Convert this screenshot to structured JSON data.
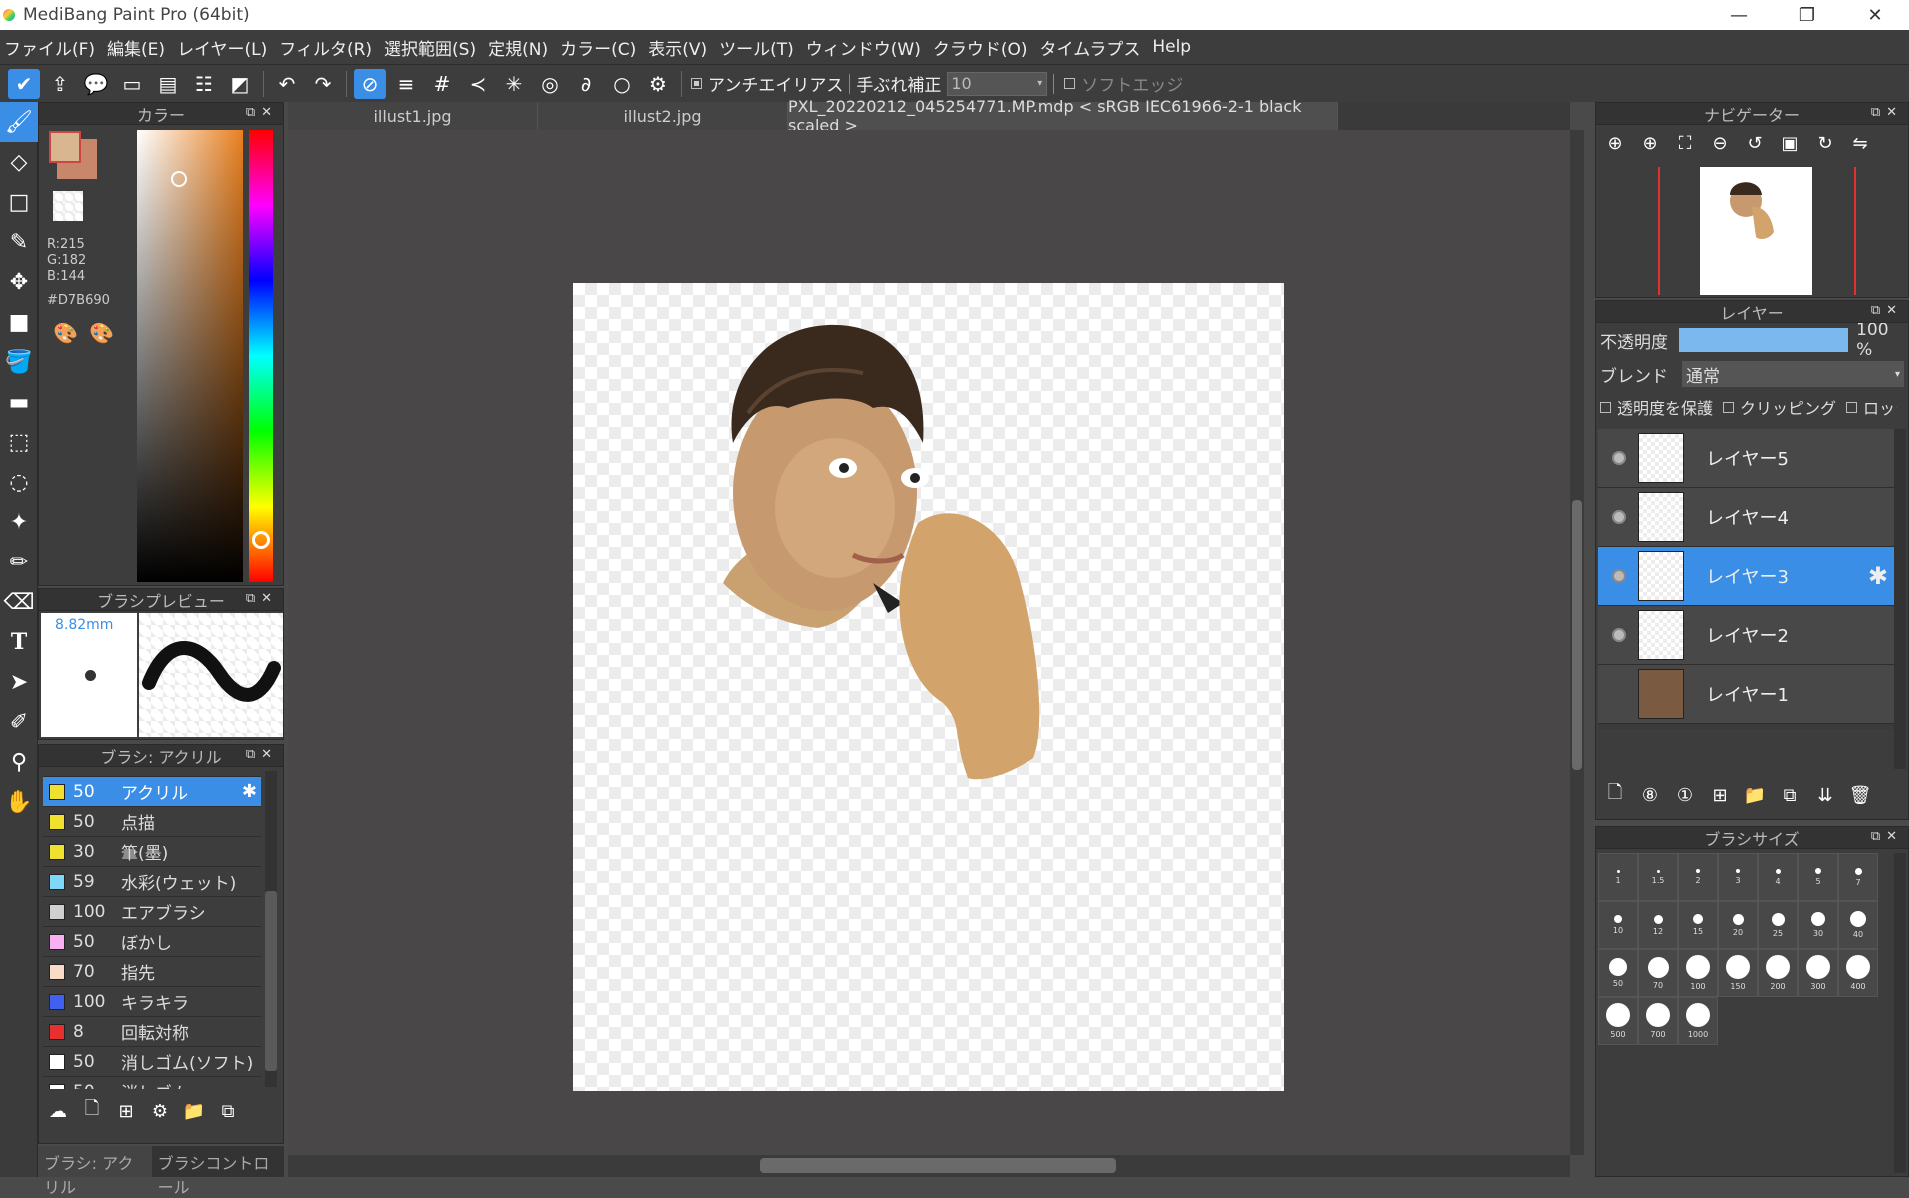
{
  "window": {
    "title": "MediBang Paint Pro (64bit)",
    "controls": [
      "—",
      "❐",
      "✕"
    ]
  },
  "menu": [
    "ファイル(F)",
    "編集(E)",
    "レイヤー(L)",
    "フィルタ(R)",
    "選択範囲(S)",
    "定規(N)",
    "カラー(C)",
    "表示(V)",
    "ツール(T)",
    "ウィンドウ(W)",
    "クラウド(O)",
    "タイムラプス",
    "Help"
  ],
  "toolbar": {
    "antialias": "アンチエイリアス",
    "stabilizer": "手ぶれ補正",
    "stabilizer_value": "10",
    "soft_edge": "ソフトエッジ"
  },
  "tabs": [
    "illust1.jpg",
    "illust2.jpg",
    "PXL_20220212_045254771.MP.mdp < sRGB IEC61966-2-1 black scaled >"
  ],
  "color_panel": {
    "title": "カラー",
    "r": "R:215",
    "g": "G:182",
    "b": "B:144",
    "hex": "#D7B690",
    "primary_color": "#D7B690",
    "secondary_color": "#c8876a"
  },
  "brush_preview": {
    "title": "ブラシプレビュー",
    "size": "8.82mm"
  },
  "brush_panel": {
    "title": "ブラシ: アクリル",
    "items": [
      {
        "size": "50",
        "name": "アクリル",
        "color": "#f0e030",
        "selected": true
      },
      {
        "size": "50",
        "name": "点描",
        "color": "#f0e030"
      },
      {
        "size": "30",
        "name": "筆(墨)",
        "color": "#f0e030"
      },
      {
        "size": "59",
        "name": "水彩(ウェット)",
        "color": "#80d8f8"
      },
      {
        "size": "100",
        "name": "エアブラシ",
        "color": "#d0d0d0"
      },
      {
        "size": "50",
        "name": "ぼかし",
        "color": "#f8b0f0"
      },
      {
        "size": "70",
        "name": "指先",
        "color": "#f8dcc8"
      },
      {
        "size": "100",
        "name": "キラキラ",
        "color": "#4060f0"
      },
      {
        "size": "8",
        "name": "回転対称",
        "color": "#e83030"
      },
      {
        "size": "50",
        "name": "消しゴム(ソフト)",
        "color": "#ffffff"
      },
      {
        "size": "50",
        "name": "消しゴム",
        "color": "#ffffff"
      }
    ]
  },
  "bottom_tabs": [
    "ブラシ: アクリル",
    "ブラシコントロール"
  ],
  "navigator": {
    "title": "ナビゲーター"
  },
  "layer_panel": {
    "title": "レイヤー",
    "opacity_label": "不透明度",
    "opacity_value": "100 %",
    "opacity_fraction": 1.0,
    "blend_label": "ブレンド",
    "blend_value": "通常",
    "protect_alpha": "透明度を保護",
    "clipping": "クリッピング",
    "lock": "ロック",
    "layers": [
      {
        "name": "レイヤー5",
        "visible": true
      },
      {
        "name": "レイヤー4",
        "visible": true
      },
      {
        "name": "レイヤー3",
        "visible": true,
        "selected": true
      },
      {
        "name": "レイヤー2",
        "visible": true
      },
      {
        "name": "レイヤー1",
        "visible": false
      }
    ]
  },
  "brush_size_panel": {
    "title": "ブラシサイズ",
    "sizes": [
      "1",
      "1.5",
      "2",
      "3",
      "4",
      "5",
      "7",
      "10",
      "12",
      "15",
      "20",
      "25",
      "30",
      "40",
      "50",
      "70",
      "100",
      "150",
      "200",
      "300",
      "400",
      "500",
      "700",
      "1000"
    ]
  }
}
